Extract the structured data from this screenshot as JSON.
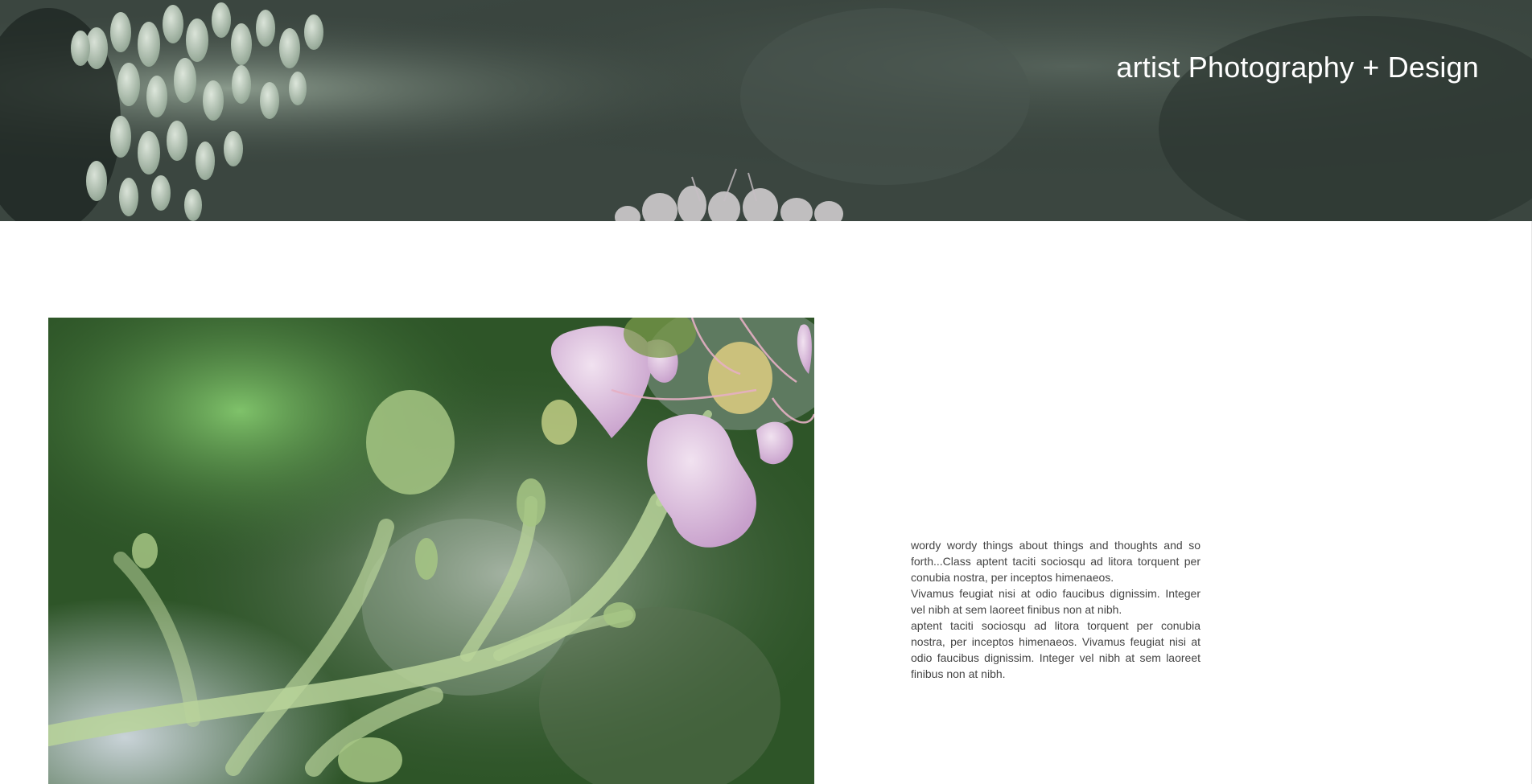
{
  "header": {
    "site_title": "artist Photography + Design"
  },
  "main": {
    "photo_icon": "flower-photo",
    "paragraphs": [
      "wordy wordy things about things and thoughts and so forth...Class aptent taciti sociosqu ad litora torquent per conubia nostra, per inceptos himenaeos.",
      "Vivamus feugiat nisi at odio faucibus dignissim. Integer vel nibh at sem laoreet finibus non at nibh.",
      "aptent taciti sociosqu ad litora torquent per conubia nostra, per inceptos himenaeos. Vivamus feugiat nisi at odio faucibus dignissim. Integer vel nibh at sem laoreet finibus non at nibh."
    ]
  },
  "colors": {
    "hero_background": "#3e4a43",
    "title_text": "#ffffff",
    "body_text": "#444444",
    "photo_foliage": "#2f5a2a",
    "blossom_pink": "#d9b8da"
  }
}
